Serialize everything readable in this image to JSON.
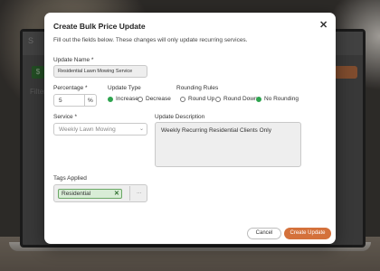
{
  "background": {
    "app_logo": "S",
    "filters_label": "Filters"
  },
  "modal": {
    "title": "Create Bulk Price Update",
    "close_icon": "close-icon",
    "subtitle": "Fill out the fields below. These changes will only update recurring services.",
    "update_name": {
      "label": "Update Name *",
      "value": "Residential Lawn Mowing Service"
    },
    "percentage": {
      "label": "Percentage *",
      "value": "5",
      "unit": "%"
    },
    "update_type": {
      "label": "Update Type",
      "options": [
        "Increase",
        "Decrease"
      ],
      "selected": "Increase"
    },
    "rounding": {
      "label": "Rounding Rules",
      "options": [
        "Round Up",
        "Round Down",
        "No Rounding"
      ],
      "selected": "No Rounding"
    },
    "service": {
      "label": "Service *",
      "value": "Weekly Lawn Mowing"
    },
    "description": {
      "label": "Update Description",
      "value": "Weekly Recurring Residential Clients Only"
    },
    "tags": {
      "label": "Tags Applied",
      "chips": [
        "Residential"
      ],
      "more": "..."
    },
    "buttons": {
      "cancel": "Cancel",
      "create": "Create Update"
    }
  },
  "colors": {
    "accent_green": "#2ea44f",
    "create_button": "#d4713b",
    "tag_bg": "#d8ecd6"
  }
}
